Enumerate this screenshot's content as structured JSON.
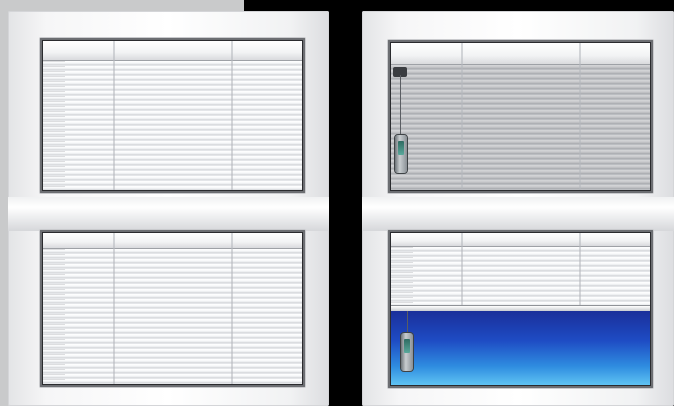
{
  "scene": {
    "description_items": [
      {
        "name": "left-window",
        "blinds": "white-lowered"
      },
      {
        "name": "right-window",
        "blinds": "grey-top-white-bottom-partially-raised"
      }
    ],
    "colors": {
      "background": "#000000",
      "frame": "#f5f6f7",
      "grey_panel": "#c9cacb",
      "sky_top": "#1a2f9a",
      "sky_bottom": "#5fc3f2"
    },
    "right_bottom_blind_lowered_fraction": 0.5
  }
}
